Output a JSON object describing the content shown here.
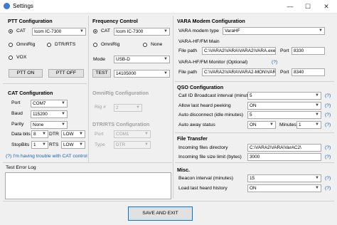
{
  "window": {
    "title": "Settings",
    "minimize": "—",
    "maximize": "☐",
    "close": "✕"
  },
  "ptt": {
    "header": "PTT Configuration",
    "cat_label": "CAT",
    "cat_value": "Icom IC-7300",
    "omnirig_label": "OmniRig",
    "dtr_label": "DTR/RTS",
    "vox_label": "VOX",
    "on_button": "PTT ON",
    "off_button": "PTT OFF"
  },
  "freq": {
    "header": "Frequency Control",
    "cat_label": "CAT",
    "cat_value": "Icom IC-7300",
    "omnirig_label": "OmniRig",
    "none_label": "None",
    "mode_label": "Mode",
    "mode_value": "USB-D",
    "test_button": "TEST",
    "test_value": "14105000"
  },
  "cat": {
    "header": "CAT Configuration",
    "port_label": "Port",
    "port_value": "COM7",
    "baud_label": "Baud",
    "baud_value": "115200",
    "parity_label": "Parity",
    "parity_value": "None",
    "databits_label": "Data bits",
    "databits_value": "8",
    "dtr_label": "DTR",
    "dtr_value": "LOW",
    "stopbits_label": "StopBits",
    "stopbits_value": "1",
    "rts_label": "RTS",
    "rts_value": "LOW",
    "trouble_link": "(?) I'm having trouble with CAT control"
  },
  "omnirig": {
    "header": "OmniRig Configuration",
    "rig_label": "Rig #",
    "rig_value": "2"
  },
  "dtrrts": {
    "header": "DTR/RTS Configuration",
    "port_label": "Port",
    "port_value": "COM1",
    "type_label": "Type",
    "type_value": "DTR"
  },
  "log": {
    "label": "Test Error Log"
  },
  "vara": {
    "header": "VARA Modem Configuration",
    "modem_type_label": "VARA modem type",
    "modem_type_value": "VaraHF",
    "hf_main_header": "VARA-HF/FM Main",
    "file_path_label": "File path",
    "main_path": "C:\\VARA2\\VARA\\VARA2\\VARA.exe",
    "port_label": "Port",
    "main_port": "8330",
    "monitor_header": "VARA-HF/FM Monitor (Optional)",
    "monitor_help": "(?)",
    "monitor_path": "C:\\VARA2\\VARA\\VARA2-MON\\VAR",
    "monitor_port": "8340"
  },
  "qso": {
    "header": "QSO Configuration",
    "callid_label": "Call ID Broadcast interval (minutes)",
    "callid_value": "5",
    "lastheard_label": "Allow last heard peeking",
    "lastheard_value": "ON",
    "autodisc_label": "Auto disconnect (idle minutes)",
    "autodisc_value": "5",
    "autoaway_label": "Auto away status",
    "autoaway_value": "ON",
    "minutes_label": "Minutes",
    "minutes_value": "1",
    "help": "(?)"
  },
  "transfer": {
    "header": "File Transfer",
    "incoming_label": "Incoming files directory",
    "incoming_value": "C:\\VARA2\\VARA\\VarAC2\\",
    "sizelimit_label": "Incoming file size limit (bytes)",
    "sizelimit_value": "3000",
    "help": "(?)"
  },
  "misc": {
    "header": "Misc.",
    "beacon_label": "Beacon interval (minutes)",
    "beacon_value": "15",
    "loadlast_label": "Load last heard history",
    "loadlast_value": "ON",
    "help": "(?)"
  },
  "footer": {
    "save_button": "SAVE AND EXIT"
  }
}
